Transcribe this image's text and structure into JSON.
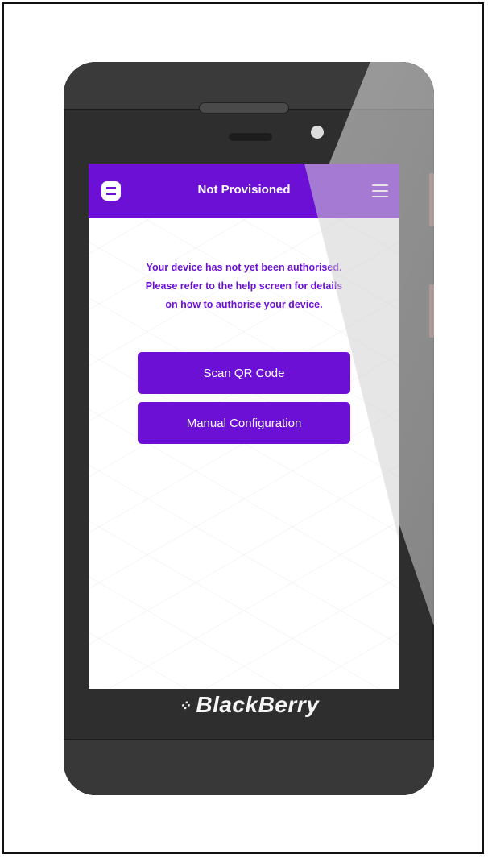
{
  "app": {
    "header_title": "Not Provisioned",
    "message_lines": [
      "Your device has not yet been authorised.",
      "Please refer to the help screen for details",
      "on how to authorise your device."
    ],
    "buttons": {
      "scan_label": "Scan QR Code",
      "manual_label": "Manual Configuration"
    }
  },
  "device": {
    "brand": "BlackBerry"
  },
  "icons": {
    "app_logo": "app-logo-icon",
    "menu": "hamburger-menu-icon",
    "brand_logo": "blackberry-logo-icon"
  },
  "colors": {
    "accent": "#6d10d6",
    "phone_body": "#2e2e2e"
  }
}
